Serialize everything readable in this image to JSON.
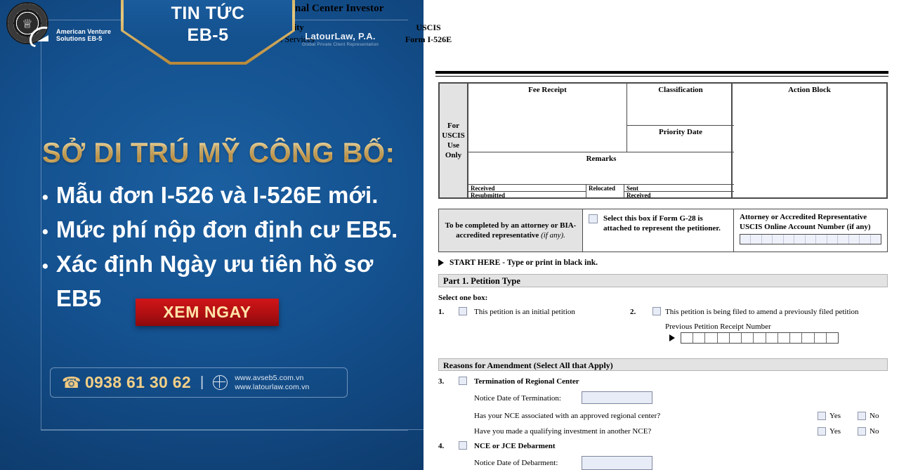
{
  "promo": {
    "badge": {
      "line1": "TIN TỨC",
      "line2": "EB-5"
    },
    "logo_left": {
      "line1": "American Venture",
      "line2": "Solutions EB-5"
    },
    "logo_right": {
      "name": "LatourLaw, P.A.",
      "tagline": "Global Private Client Representation"
    },
    "headline": "SỞ DI TRÚ MỸ CÔNG BỐ:",
    "bullets": [
      "Mẫu đơn I-526 và I-526E mới.",
      "Mức phí nộp đơn định cư EB5.",
      "Xác định Ngày ưu tiên hồ sơ EB5"
    ],
    "cta_label": "XEM NGAY",
    "contact": {
      "phone": "0938 61 30 62",
      "divider": "|",
      "url1": "www.avseb5.com.vn",
      "url2": "www.latourlaw.com.vn"
    },
    "colors": {
      "bg_light": "#1b5fa0",
      "bg_dark": "#0c3260",
      "gold": "#e6c87d",
      "cta_red": "#c01316"
    }
  },
  "form": {
    "title": "Immigrant Petition by Regional Center Investor",
    "dept": "Department of Homeland Security",
    "agency": "U.S. Citizenship and Immigration Services",
    "uscis_label": "USCIS",
    "form_number": "Form I-526E",
    "uscis_use": {
      "side_label": "For\nUSCIS\nUse\nOnly",
      "side_label_lines": [
        "For",
        "USCIS",
        "Use",
        "Only"
      ],
      "fee_receipt": "Fee Receipt",
      "classification": "Classification",
      "priority_date": "Priority Date",
      "action_block": "Action Block",
      "remarks": "Remarks",
      "received": "Received",
      "resubmitted": "Resubmitted",
      "relocated": "Relocated",
      "sent": "Sent",
      "received2": "Received"
    },
    "attorney": {
      "left_text_bold": "To be completed by an attorney or BIA-accredited representative",
      "left_text_italic": "(if any).",
      "checkbox_text": "Select this box if Form G-28 is attached to represent the petitioner.",
      "right_label_l1": "Attorney or Accredited Representative",
      "right_label_l2": "USCIS Online Account Number (if any)",
      "account_cells": 13
    },
    "start_here": "START HERE - Type or print in black ink.",
    "part1": {
      "heading": "Part 1.  Petition Type",
      "select_one": "Select one box:",
      "item1_num": "1.",
      "item1_text": "This petition is an initial petition",
      "item2_num": "2.",
      "item2_text": "This petition is being filed to amend a previously filed petition",
      "prev_receipt_label": "Previous Petition Receipt Number",
      "receipt_cells": 13
    },
    "amendment": {
      "heading": "Reasons for Amendment (Select All that Apply)",
      "item3_num": "3.",
      "item3_text": "Termination of Regional Center",
      "notice_termination_label": "Notice Date of Termination:",
      "q1": "Has your NCE associated with an approved regional center?",
      "q2": "Have you made a qualifying investment in another NCE?",
      "yes": "Yes",
      "no": "No",
      "item4_num": "4.",
      "item4_text": "NCE or JCE Debarment",
      "notice_debarment_label": "Notice Date of Debarment:"
    }
  }
}
